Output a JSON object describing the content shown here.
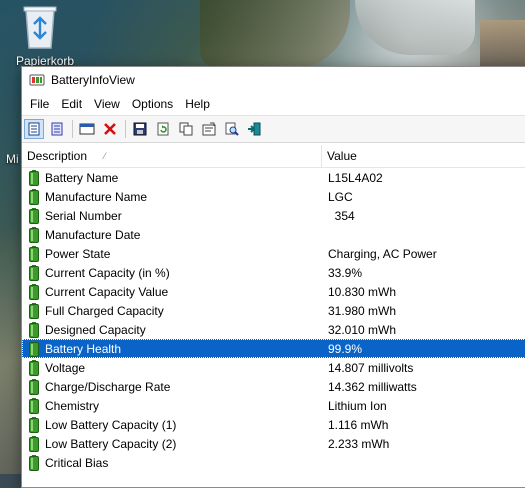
{
  "desktop": {
    "recycle_bin_label": "Papierkorb",
    "side_label": "Mi"
  },
  "window": {
    "title": "BatteryInfoView"
  },
  "menu": [
    "File",
    "Edit",
    "View",
    "Options",
    "Help"
  ],
  "toolbar": {
    "buttons": [
      {
        "name": "view-details-icon",
        "active": true
      },
      {
        "name": "view-list-icon",
        "active": false
      },
      {
        "name": "window-icon",
        "active": false
      },
      {
        "name": "delete-icon",
        "active": false
      },
      {
        "name": "save-icon",
        "active": false
      },
      {
        "name": "refresh-icon",
        "active": false
      },
      {
        "name": "copy-icon",
        "active": false
      },
      {
        "name": "properties-icon",
        "active": false
      },
      {
        "name": "find-icon",
        "active": false
      },
      {
        "name": "exit-icon",
        "active": false
      }
    ]
  },
  "columns": {
    "description": "Description",
    "value": "Value"
  },
  "rows": [
    {
      "desc": "Battery Name",
      "value": "L15L4A02"
    },
    {
      "desc": "Manufacture Name",
      "value": "LGC"
    },
    {
      "desc": "Serial Number",
      "value": "  354"
    },
    {
      "desc": "Manufacture Date",
      "value": ""
    },
    {
      "desc": "Power State",
      "value": "Charging, AC Power"
    },
    {
      "desc": "Current Capacity (in %)",
      "value": "33.9%"
    },
    {
      "desc": "Current Capacity Value",
      "value": "10.830 mWh"
    },
    {
      "desc": "Full Charged Capacity",
      "value": "31.980 mWh"
    },
    {
      "desc": "Designed Capacity",
      "value": "32.010 mWh"
    },
    {
      "desc": "Battery Health",
      "value": "99.9%",
      "selected": true
    },
    {
      "desc": "Voltage",
      "value": "14.807 millivolts"
    },
    {
      "desc": "Charge/Discharge Rate",
      "value": "14.362 milliwatts"
    },
    {
      "desc": "Chemistry",
      "value": "Lithium Ion"
    },
    {
      "desc": "Low Battery Capacity (1)",
      "value": "1.116 mWh"
    },
    {
      "desc": "Low Battery Capacity (2)",
      "value": "2.233 mWh"
    },
    {
      "desc": "Critical Bias",
      "value": ""
    }
  ],
  "colors": {
    "selection": "#0a64c8",
    "battery_green": "#3a9a2a"
  }
}
